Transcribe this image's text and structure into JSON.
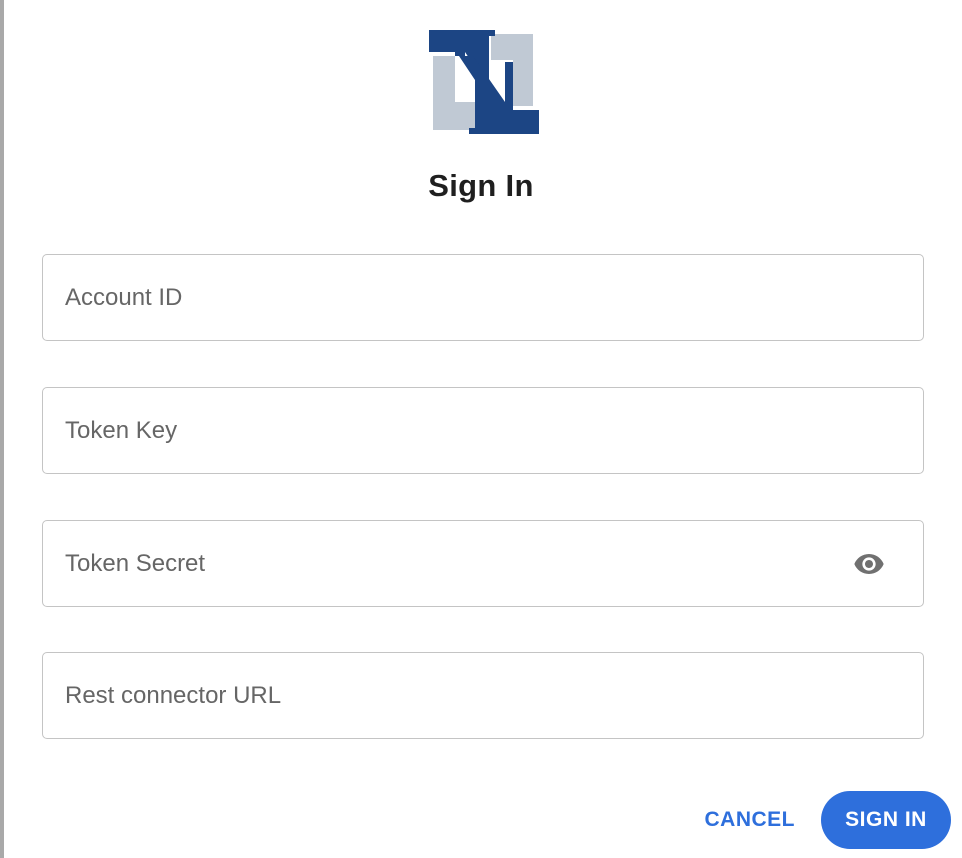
{
  "dialog": {
    "title": "Sign In"
  },
  "logo": {
    "icon": "netsuite-n-logo",
    "dark_color": "#1c4584",
    "light_color": "#c0c9d4"
  },
  "fields": {
    "account_id": {
      "placeholder": "Account ID",
      "value": ""
    },
    "token_key": {
      "placeholder": "Token Key",
      "value": ""
    },
    "token_secret": {
      "placeholder": "Token Secret",
      "value": "",
      "toggle_icon": "eye-icon"
    },
    "rest_connector_url": {
      "placeholder": "Rest connector URL",
      "value": ""
    }
  },
  "actions": {
    "cancel_label": "CANCEL",
    "sign_in_label": "SIGN IN"
  },
  "colors": {
    "accent": "#2e6fdc",
    "field_border": "#c4c4c4",
    "placeholder": "#666666"
  }
}
